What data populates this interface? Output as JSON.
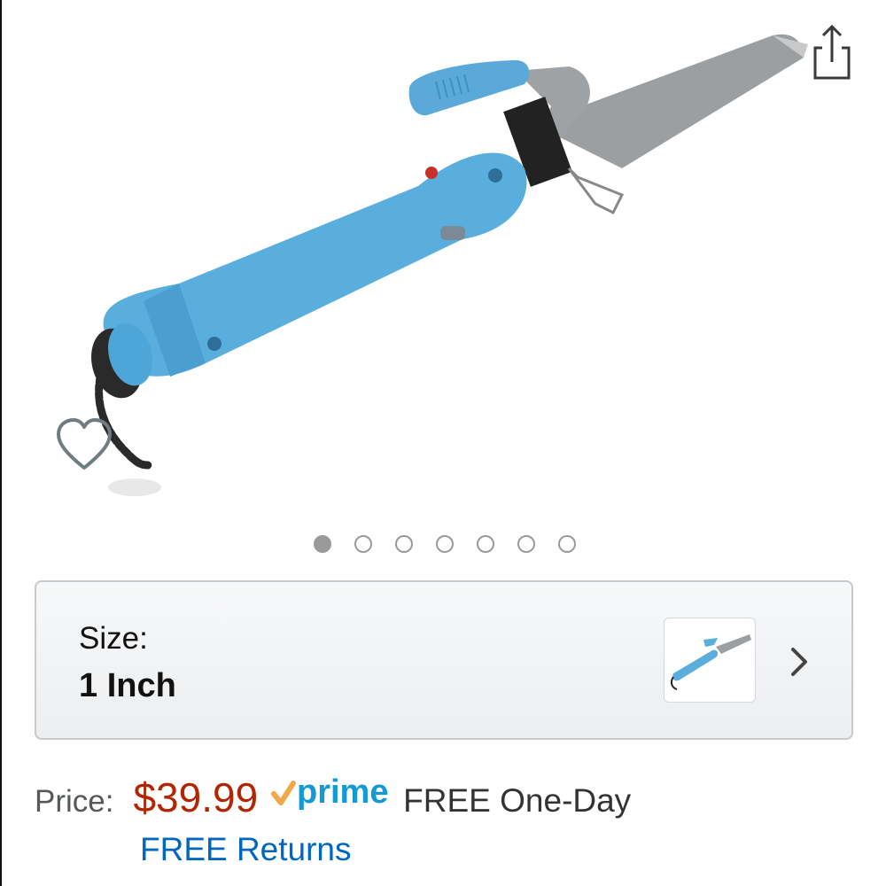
{
  "product": {
    "image_name": "blue-curling-iron-product-photo",
    "carousel": {
      "total_images": 7,
      "active_index": 0
    }
  },
  "icons": {
    "share": "share-icon",
    "wishlist": "heart-outline-icon",
    "chevron": "chevron-right-icon"
  },
  "size_selector": {
    "label": "Size:",
    "value": "1 Inch"
  },
  "pricing": {
    "label": "Price:",
    "price": "$39.99",
    "prime_label": "prime",
    "shipping": "FREE One-Day",
    "returns": "FREE Returns"
  },
  "colors": {
    "price": "#b12704",
    "link": "#0066c0",
    "prime_check": "#f3a847",
    "prime_text": "#1399d6"
  }
}
